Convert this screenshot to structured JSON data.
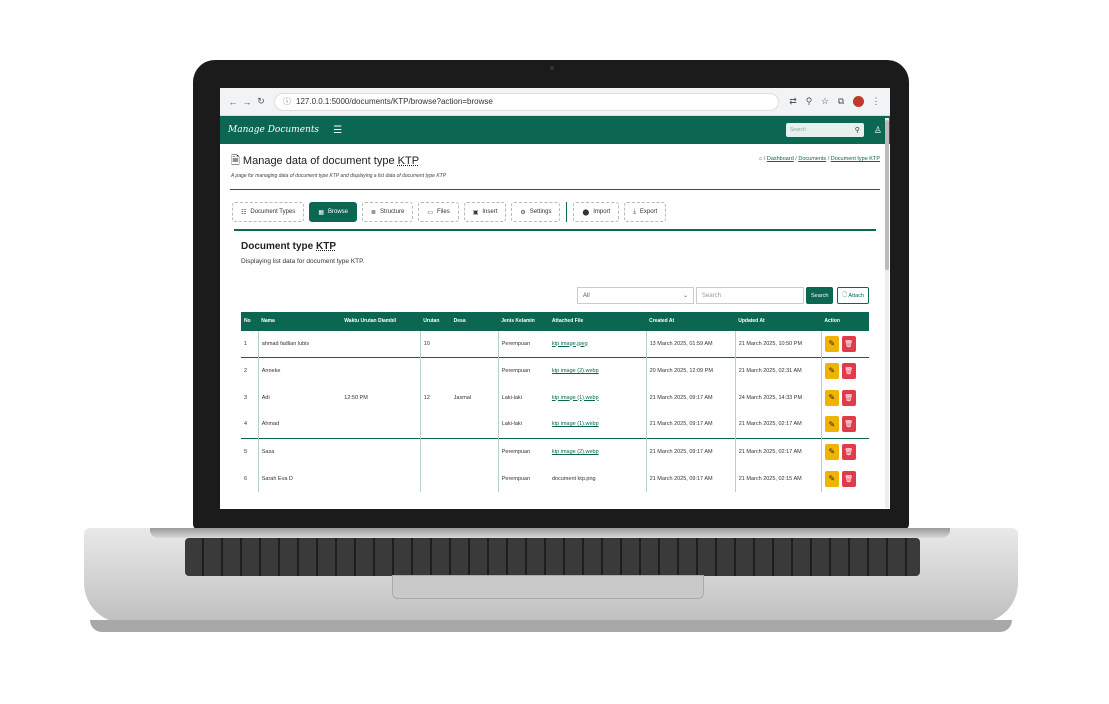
{
  "browser": {
    "url": "127.0.0.1:5000/documents/KTP/browse?action=browse",
    "icons": [
      "arrow-left-icon",
      "arrow-right-icon",
      "reload-icon",
      "info-icon",
      "translate-icon",
      "zoom-icon",
      "star-icon",
      "extensions-icon",
      "menu-icon"
    ]
  },
  "header": {
    "brand": "Manage Documents",
    "search_placeholder": "Search"
  },
  "page": {
    "title_prefix": "Manage data of document type ",
    "title_kw": "KTP",
    "subtitle": "A page for managing data of document type KTP and displaying a list data of document type KTP",
    "breadcrumb": [
      "Dashboard",
      "Documents",
      "Document type KTP"
    ]
  },
  "toolbar": {
    "document_types": "Document Types",
    "browse": "Browse",
    "structure": "Structure",
    "files": "Files",
    "insert": "Insert",
    "settings": "Settings",
    "import": "Import",
    "export": "Export"
  },
  "card": {
    "title_prefix": "Document type ",
    "title_kw": "KTP",
    "subtitle": "Displaying list data for document type KTP."
  },
  "filter": {
    "select_value": "All",
    "search_placeholder": "Search",
    "search_button": "Search",
    "attach_button": "Attach"
  },
  "table": {
    "columns": [
      "No",
      "Nama",
      "Waktu Urutan Diambil",
      "Urutan",
      "Desa",
      "Jenis Kelamin",
      "Attached File",
      "Created At",
      "Updated At",
      "Action"
    ],
    "rows": [
      {
        "no": "1",
        "nama": "ahmad fadlian lubis",
        "waktu": "",
        "urutan": "10",
        "desa": "",
        "jk": "Perempuan",
        "file": "ktp image.jpeg",
        "created": "13 March 2025, 01:59 AM",
        "updated": "21 March 2025, 10:50 PM"
      },
      {
        "no": "2",
        "nama": "Anneke",
        "waktu": "",
        "urutan": "",
        "desa": "",
        "jk": "Perempuan",
        "file": "ktp image (2).webp",
        "created": "20 March 2025, 12:09 PM",
        "updated": "21 March 2025, 02:31 AM"
      },
      {
        "no": "3",
        "nama": "Adi",
        "waktu": "12:50 PM",
        "urutan": "12",
        "desa": "Jasmal",
        "jk": "Laki-laki",
        "file": "ktp image (1).webp",
        "created": "21 March 2025, 09:17 AM",
        "updated": "24 March 2025, 14:33 PM"
      },
      {
        "no": "4",
        "nama": "Ahmad",
        "waktu": "",
        "urutan": "",
        "desa": "",
        "jk": "Laki-laki",
        "file": "ktp image (1).webp",
        "created": "21 March 2025, 09:17 AM",
        "updated": "21 March 2025, 02:17 AM"
      },
      {
        "no": "5",
        "nama": "Sasa",
        "waktu": "",
        "urutan": "",
        "desa": "",
        "jk": "Perempuan",
        "file": "ktp image (2).webp",
        "created": "21 March 2025, 09:17 AM",
        "updated": "21 March 2025, 02:17 AM"
      },
      {
        "no": "6",
        "nama": "Sarah Eva D",
        "waktu": "",
        "urutan": "",
        "desa": "",
        "jk": "Perempuan",
        "file": "document ktp.png",
        "created": "21 March 2025, 09:17 AM",
        "updated": "21 March 2025, 02:15 AM"
      }
    ]
  },
  "colors": {
    "primary": "#0b6652",
    "edit": "#f0b400",
    "delete": "#e13b4a"
  }
}
